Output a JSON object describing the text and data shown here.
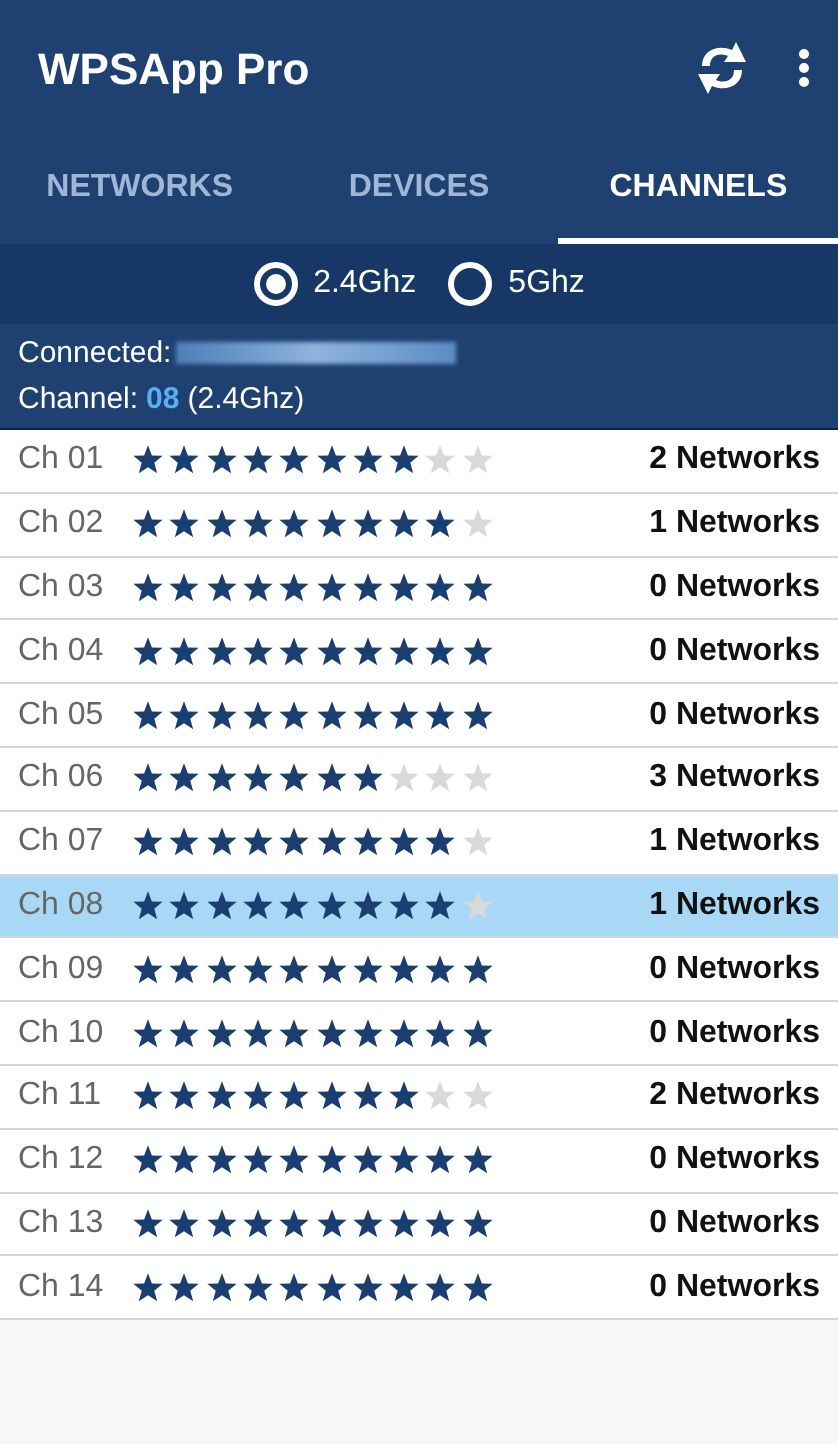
{
  "app_bar": {
    "title": "WPSApp Pro"
  },
  "tabs": [
    {
      "label": "NETWORKS",
      "selected": false
    },
    {
      "label": "DEVICES",
      "selected": false
    },
    {
      "label": "CHANNELS",
      "selected": true
    }
  ],
  "bands": [
    {
      "label": "2.4Ghz",
      "selected": true
    },
    {
      "label": "5Ghz",
      "selected": false
    }
  ],
  "info": {
    "connected_label": "Connected:",
    "channel_label": "Channel:",
    "channel_value": "08",
    "channel_band": "(2.4Ghz)"
  },
  "channels": [
    {
      "name": "Ch 01",
      "stars": 8,
      "networks": "2 Networks",
      "selected": false
    },
    {
      "name": "Ch 02",
      "stars": 9,
      "networks": "1 Networks",
      "selected": false
    },
    {
      "name": "Ch 03",
      "stars": 10,
      "networks": "0 Networks",
      "selected": false
    },
    {
      "name": "Ch 04",
      "stars": 10,
      "networks": "0 Networks",
      "selected": false
    },
    {
      "name": "Ch 05",
      "stars": 10,
      "networks": "0 Networks",
      "selected": false
    },
    {
      "name": "Ch 06",
      "stars": 7,
      "networks": "3 Networks",
      "selected": false
    },
    {
      "name": "Ch 07",
      "stars": 9,
      "networks": "1 Networks",
      "selected": false
    },
    {
      "name": "Ch 08",
      "stars": 9,
      "networks": "1 Networks",
      "selected": true
    },
    {
      "name": "Ch 09",
      "stars": 10,
      "networks": "0 Networks",
      "selected": false
    },
    {
      "name": "Ch 10",
      "stars": 10,
      "networks": "0 Networks",
      "selected": false
    },
    {
      "name": "Ch 11",
      "stars": 8,
      "networks": "2 Networks",
      "selected": false
    },
    {
      "name": "Ch 12",
      "stars": 10,
      "networks": "0 Networks",
      "selected": false
    },
    {
      "name": "Ch 13",
      "stars": 10,
      "networks": "0 Networks",
      "selected": false
    },
    {
      "name": "Ch 14",
      "stars": 10,
      "networks": "0 Networks",
      "selected": false
    }
  ]
}
